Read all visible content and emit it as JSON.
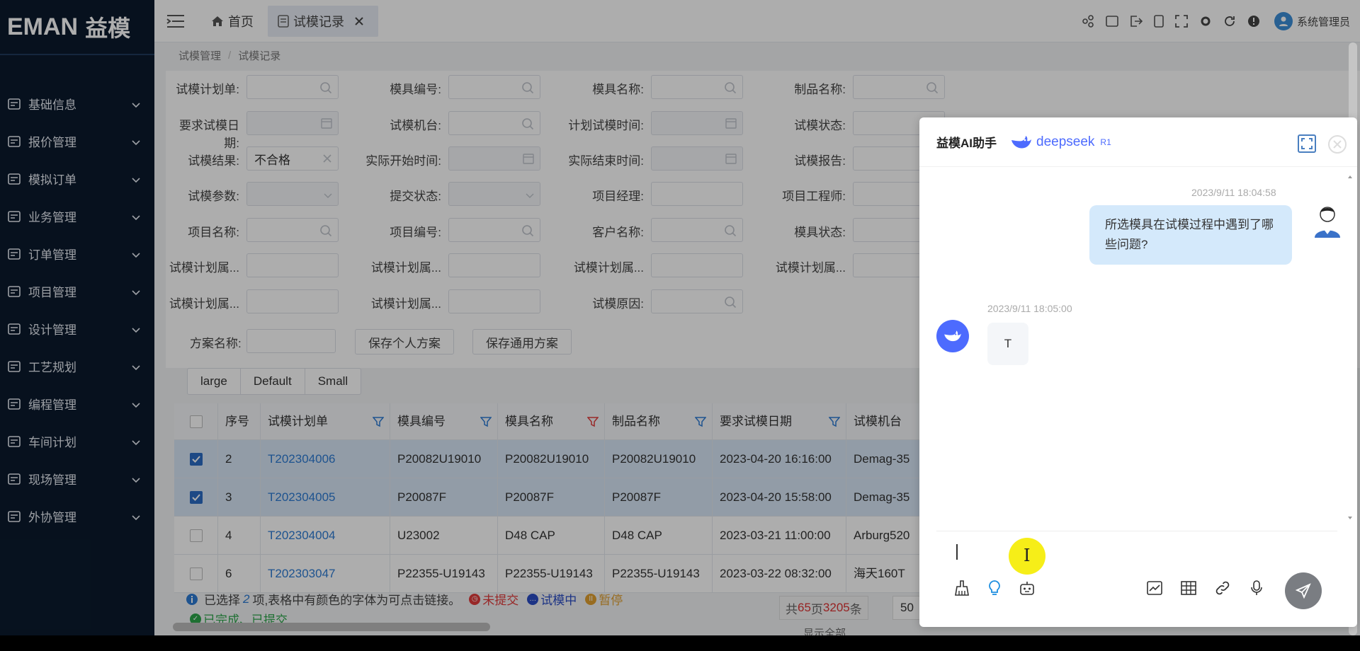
{
  "sidebar": {
    "logo_en": "EMAN",
    "logo_cn": "益模",
    "items": [
      {
        "label": "基础信息",
        "icon": "database-icon"
      },
      {
        "label": "报价管理",
        "icon": "quote-icon"
      },
      {
        "label": "模拟订单",
        "icon": "edit-order-icon"
      },
      {
        "label": "业务管理",
        "icon": "briefcase-icon"
      },
      {
        "label": "订单管理",
        "icon": "order-icon"
      },
      {
        "label": "项目管理",
        "icon": "project-icon"
      },
      {
        "label": "设计管理",
        "icon": "design-icon"
      },
      {
        "label": "工艺规划",
        "icon": "process-icon"
      },
      {
        "label": "编程管理",
        "icon": "bar-chart-icon"
      },
      {
        "label": "车间计划",
        "icon": "workshop-icon"
      },
      {
        "label": "现场管理",
        "icon": "monitor-icon"
      },
      {
        "label": "外协管理",
        "icon": "outsource-icon"
      }
    ]
  },
  "topbar": {
    "home_tab": "首页",
    "active_tab": "试模记录",
    "user_name": "系统管理员"
  },
  "breadcrumb": {
    "root": "试模管理",
    "current": "试模记录"
  },
  "filters": {
    "plan_no": "试模计划单:",
    "mold_no": "模具编号:",
    "mold_name": "模具名称:",
    "product_name": "制品名称:",
    "req_date": "要求试模日期:",
    "machine": "试模机台:",
    "plan_time": "计划试模时间:",
    "status": "试模状态:",
    "result": "试模结果:",
    "result_value": "不合格",
    "actual_start": "实际开始时间:",
    "actual_end": "实际结束时间:",
    "report": "试模报告:",
    "params": "试模参数:",
    "submit_status": "提交状态:",
    "pm": "项目经理:",
    "pe": "项目工程师:",
    "project_name": "项目名称:",
    "project_no": "项目编号:",
    "customer": "客户名称:",
    "mold_status": "模具状态:",
    "attr": "试模计划属...",
    "reason": "试模原因:",
    "scheme": "方案名称:",
    "save_personal": "保存个人方案",
    "save_common": "保存通用方案"
  },
  "sizes": [
    "large",
    "Default",
    "Small"
  ],
  "table": {
    "headers": [
      "序号",
      "试模计划单",
      "模具编号",
      "模具名称",
      "制品名称",
      "要求试模日期",
      "试模机台"
    ],
    "rows": [
      {
        "checked": true,
        "no": "2",
        "plan": "T202304006",
        "mold_no": "P20082U19010",
        "mold_name": "P20082U19010",
        "product": "P20082U19010",
        "date": "2023-04-20 16:16:00",
        "machine": "Demag-35"
      },
      {
        "checked": true,
        "no": "3",
        "plan": "T202304005",
        "mold_no": "P20087F",
        "mold_name": "P20087F",
        "product": "P20087F",
        "date": "2023-04-20 15:58:00",
        "machine": "Demag-35"
      },
      {
        "checked": false,
        "no": "4",
        "plan": "T202304004",
        "mold_no": "U23002",
        "mold_name": "D48 CAP",
        "product": "D48 CAP",
        "date": "2023-03-21 11:00:00",
        "machine": "Arburg520"
      },
      {
        "checked": false,
        "no": "6",
        "plan": "T202303047",
        "mold_no": "P22355-U19143",
        "mold_name": "P22355-U19143",
        "product": "P22355-U19143",
        "date": "2023-03-22 08:32:00",
        "machine": "海天160T"
      }
    ]
  },
  "footer": {
    "selected_prefix": "已选择",
    "selected_count": "2",
    "selected_suffix": "项,表格中有颜色的字体为可点击链接。",
    "legend_unsubmitted": "未提交",
    "legend_in_progress": "试模中",
    "legend_paused": "暂停",
    "legend_done": "已完成、已提交",
    "pager_prefix": "共",
    "pages": "65",
    "pager_mid": "页",
    "records": "3205",
    "pager_suffix": "条",
    "page_size": "50",
    "show_all": "显示全部"
  },
  "chat": {
    "title": "益模AI助手",
    "brand": "deepseek",
    "brand_tag": "R1",
    "user_time": "2023/9/11 18:04:58",
    "user_msg": "所选模具在试模过程中遇到了哪些问题?",
    "ai_time": "2023/9/11 18:05:00",
    "ai_msg": "T"
  },
  "colors": {
    "sidebar_bg": "#0b1a2d",
    "link": "#2d7bd3",
    "user_bubble": "#d4e9fb",
    "deepseek_blue": "#4d6bfe",
    "cursor_highlight": "#f6ee18"
  }
}
